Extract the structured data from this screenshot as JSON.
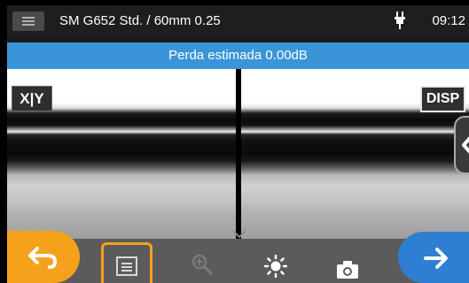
{
  "status_bar": {
    "title": "SM G652 Std. / 60mm 0.25",
    "time": "09:12",
    "menu_icon": "hamburger-menu-icon",
    "power_icon": "plug-icon"
  },
  "banner": {
    "text": "Perda estimada  0.00dB"
  },
  "views": {
    "xy_label": "X|Y",
    "disp_label": "DISP",
    "side_icon": "chevron-left-icon"
  },
  "toolbar": {
    "icons": [
      "back-arrow-icon",
      "list-icon",
      "zoom-in-icon",
      "brightness-icon",
      "camera-icon",
      "forward-arrow-icon"
    ]
  },
  "colors": {
    "banner": "#3a95d8",
    "back_button": "#f4a21c",
    "next_button": "#2e7fd2",
    "toolbar": "#5b5b5b"
  }
}
